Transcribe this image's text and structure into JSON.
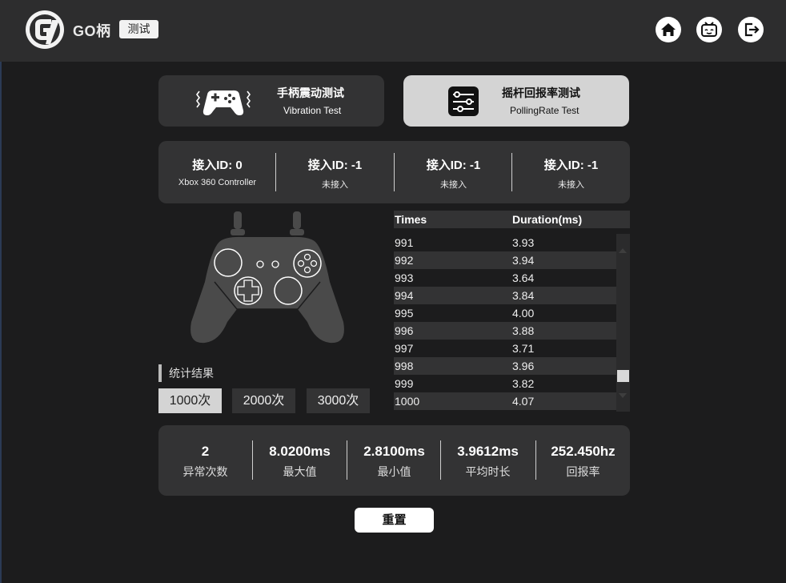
{
  "header": {
    "brand": "GO柄",
    "tag": "测试",
    "icons": [
      "home-icon",
      "tv-icon",
      "exit-icon"
    ]
  },
  "tabs": [
    {
      "title": "手柄震动测试",
      "subtitle": "Vibration Test",
      "icon": "gamepad-vibration-icon",
      "active": false
    },
    {
      "title": "摇杆回报率测试",
      "subtitle": "PollingRate Test",
      "icon": "sliders-icon",
      "active": true
    }
  ],
  "controllers": [
    {
      "label": "接入ID: 0",
      "name": "Xbox 360 Controller"
    },
    {
      "label": "接入ID: -1",
      "name": "未接入"
    },
    {
      "label": "接入ID: -1",
      "name": "未接入"
    },
    {
      "label": "接入ID: -1",
      "name": "未接入"
    }
  ],
  "stats": {
    "label": "统计结果",
    "buttons": [
      "1000次",
      "2000次",
      "3000次"
    ],
    "selected": "1000次"
  },
  "table": {
    "headers": [
      "Times",
      "Duration(ms)"
    ],
    "rows": [
      [
        "991",
        "3.93"
      ],
      [
        "992",
        "3.94"
      ],
      [
        "993",
        "3.64"
      ],
      [
        "994",
        "3.84"
      ],
      [
        "995",
        "4.00"
      ],
      [
        "996",
        "3.88"
      ],
      [
        "997",
        "3.71"
      ],
      [
        "998",
        "3.96"
      ],
      [
        "999",
        "3.82"
      ],
      [
        "1000",
        "4.07"
      ]
    ]
  },
  "summary": [
    {
      "value": "2",
      "label": "异常次数"
    },
    {
      "value": "8.0200ms",
      "label": "最大值"
    },
    {
      "value": "2.8100ms",
      "label": "最小值"
    },
    {
      "value": "3.9612ms",
      "label": "平均时长"
    },
    {
      "value": "252.450hz",
      "label": "回报率"
    }
  ],
  "reset_label": "重置",
  "colors": {
    "background": "#1c1c1d",
    "panel": "#333334",
    "active": "#d4d4d4"
  }
}
